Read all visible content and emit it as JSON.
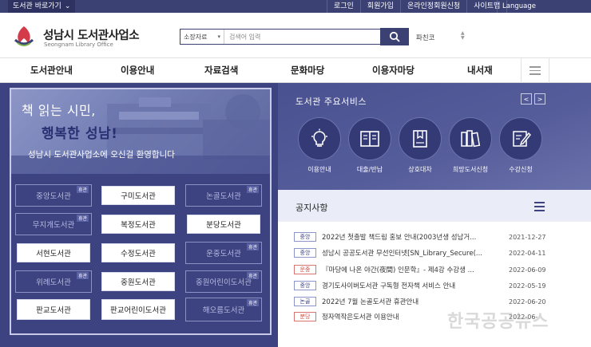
{
  "topbar": {
    "shortcut": "도서관 바로가기",
    "links": [
      "로그인",
      "회원가입",
      "온라인정회원신청",
      "사이트맵"
    ],
    "language": "Language"
  },
  "header": {
    "logo_title": "성남시 도서관사업소",
    "logo_sub": "Seongnam Library Office",
    "search_category": "소장자료",
    "search_placeholder": "검색어 입력",
    "keyword_label": "파친코"
  },
  "nav": [
    "도서관안내",
    "이용안내",
    "자료검색",
    "문화마당",
    "이용자마당",
    "내서재"
  ],
  "hero": {
    "line1": "책 읽는 시민,",
    "line2": "행복한 성남!",
    "welcome": "성남시 도서관사업소에 오신걸 환영합니다",
    "closed_tag": "휴관",
    "branches": [
      {
        "name": "중앙도서관",
        "active": false,
        "closed": true
      },
      {
        "name": "구미도서관",
        "active": true,
        "closed": false
      },
      {
        "name": "논골도서관",
        "active": false,
        "closed": true
      },
      {
        "name": "무지개도서관",
        "active": false,
        "closed": true
      },
      {
        "name": "복정도서관",
        "active": true,
        "closed": false
      },
      {
        "name": "분당도서관",
        "active": true,
        "closed": false
      },
      {
        "name": "서현도서관",
        "active": true,
        "closed": false
      },
      {
        "name": "수정도서관",
        "active": true,
        "closed": false
      },
      {
        "name": "운중도서관",
        "active": false,
        "closed": true
      },
      {
        "name": "위례도서관",
        "active": false,
        "closed": true
      },
      {
        "name": "중원도서관",
        "active": true,
        "closed": false
      },
      {
        "name": "중원어린이도서관",
        "active": false,
        "closed": true
      },
      {
        "name": "판교도서관",
        "active": true,
        "closed": false
      },
      {
        "name": "판교어린이도서관",
        "active": true,
        "closed": false
      },
      {
        "name": "해오름도서관",
        "active": false,
        "closed": true
      }
    ]
  },
  "services": {
    "title": "도서관 주요서비스",
    "items": [
      {
        "label": "이용안내",
        "icon": "lightbulb-icon"
      },
      {
        "label": "대출/반납",
        "icon": "book-open-icon"
      },
      {
        "label": "상호대차",
        "icon": "bookmark-book-icon"
      },
      {
        "label": "희망도서신청",
        "icon": "books-icon"
      },
      {
        "label": "수강신청",
        "icon": "pencil-note-icon"
      }
    ]
  },
  "notices": {
    "title": "공지사항",
    "rows": [
      {
        "badge": "중앙",
        "badge_color": "#3d4380",
        "text": "2022년 첫출발 책드림 홍보 안내(2003년생 성남거...",
        "date": "2021-12-27"
      },
      {
        "badge": "중앙",
        "badge_color": "#3d4380",
        "text": "성남시 공공도서관 무선인터넷[SN_Library_Secure(...",
        "date": "2022-04-11"
      },
      {
        "badge": "운중",
        "badge_color": "#c94b43",
        "text": "『마당에 나온 야간(夜間) 인문학』- 제4강 수강생 ...",
        "date": "2022-06-09"
      },
      {
        "badge": "중앙",
        "badge_color": "#3d4380",
        "text": "경기도사이버도서관 구독형 전자책 서비스 안내",
        "date": "2022-05-19"
      },
      {
        "badge": "논골",
        "badge_color": "#3d4380",
        "text": "2022년 7월 논골도서관 휴관안내",
        "date": "2022-06-20"
      },
      {
        "badge": "분당",
        "badge_color": "#c94b43",
        "text": "정자역작은도서관 이용안내",
        "date": "2022-06-"
      }
    ]
  },
  "watermark": "한국공공뉴스",
  "colors": {
    "brand": "#3b4173",
    "accent_red": "#c94b43"
  }
}
